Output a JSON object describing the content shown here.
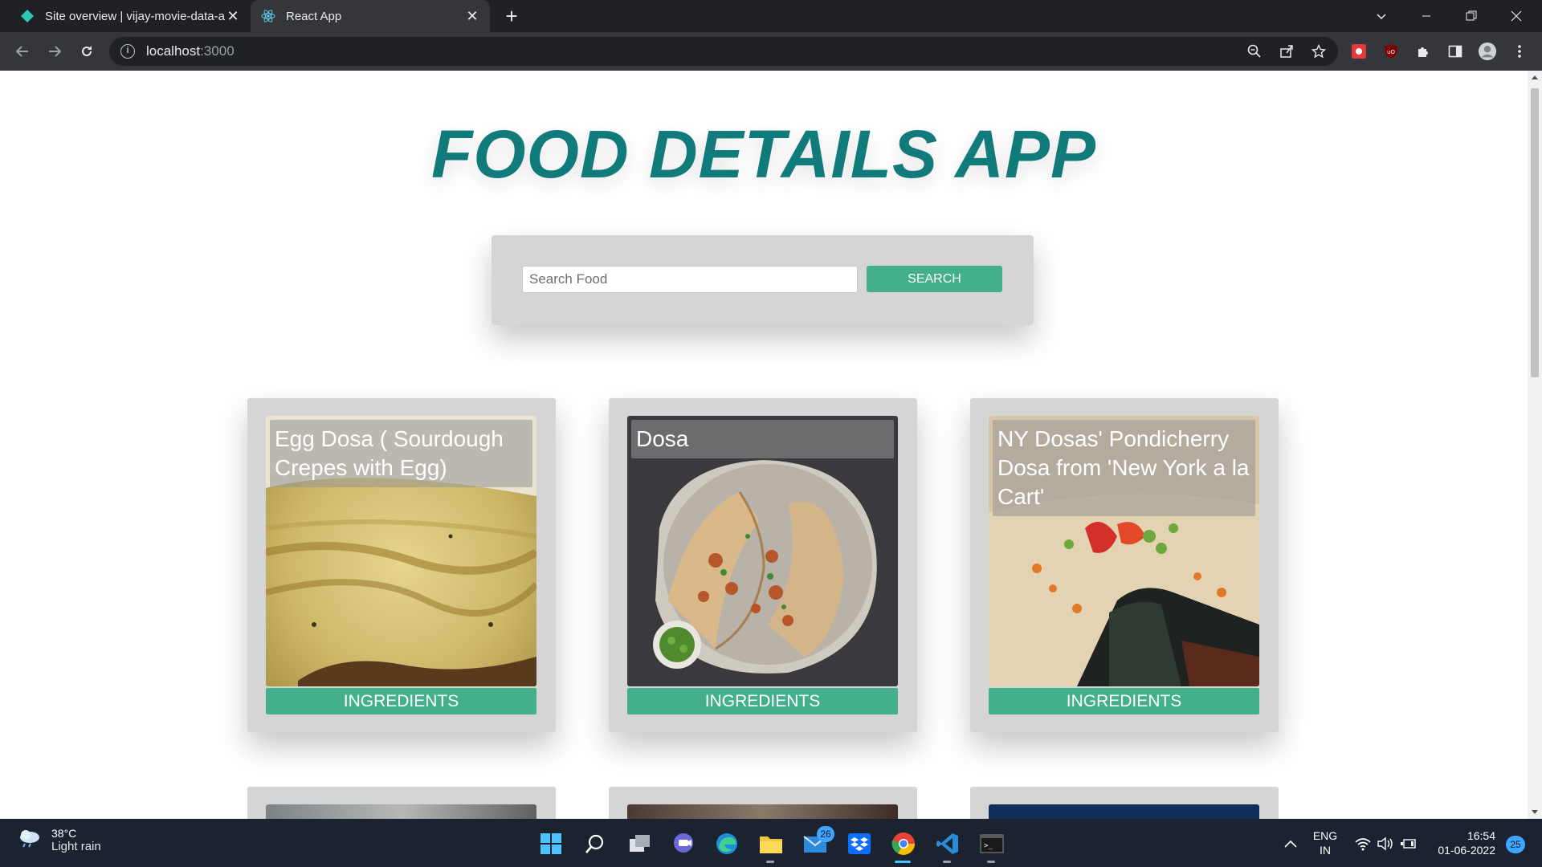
{
  "browser": {
    "tabs": [
      {
        "title": "Site overview | vijay-movie-data-a",
        "active": false
      },
      {
        "title": "React App",
        "active": true
      }
    ],
    "url_host": "localhost",
    "url_port": ":3000"
  },
  "app": {
    "title": "FOOD DETAILS APP",
    "search": {
      "placeholder": "Search Food",
      "value": "",
      "button_label": "SEARCH"
    },
    "cards": [
      {
        "name": "Egg Dosa ( Sourdough Crepes with Egg)",
        "button_label": "INGREDIENTS"
      },
      {
        "name": "Dosa",
        "button_label": "INGREDIENTS"
      },
      {
        "name": "NY Dosas' Pondicherry Dosa from 'New York a la Cart'",
        "button_label": "INGREDIENTS"
      }
    ]
  },
  "taskbar": {
    "weather_temp": "38°C",
    "weather_desc": "Light rain",
    "mail_badge": "26",
    "lang_top": "ENG",
    "lang_bottom": "IN",
    "time": "16:54",
    "date": "01-06-2022",
    "notif_count": "25"
  },
  "colors": {
    "accent": "#43b08a",
    "title": "#117a7a",
    "card_bg": "#d5d5d5"
  }
}
